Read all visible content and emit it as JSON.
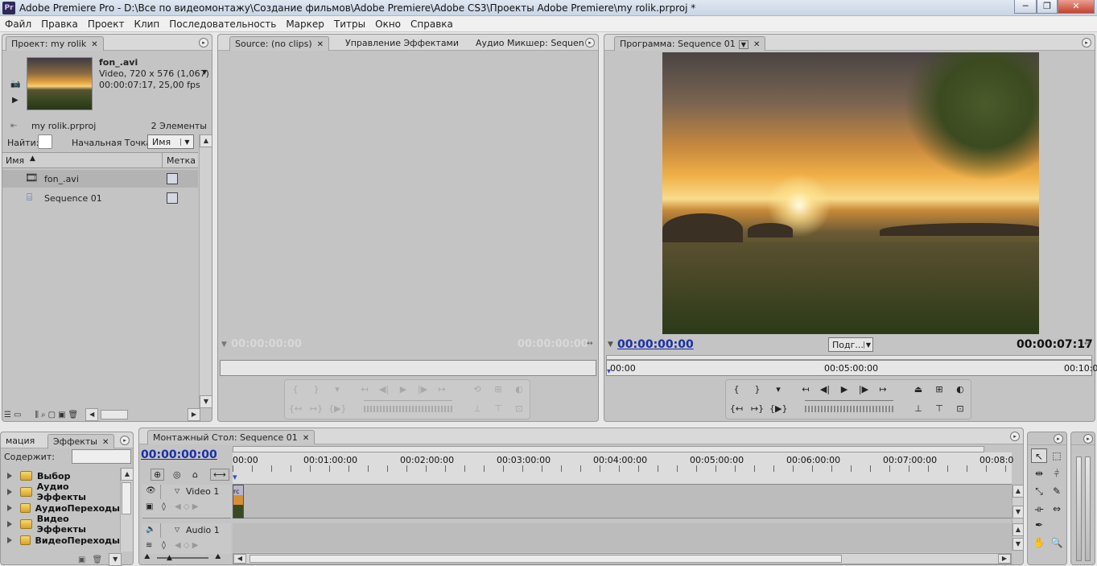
{
  "window": {
    "app_icon": "Pr",
    "title": "Adobe Premiere Pro - D:\\Все по видеомонтажу\\Создание фильмов\\Adobe Premiere\\Adobe CS3\\Проекты Adobe Premiere\\my rolik.prproj *",
    "controls": {
      "minimize": "─",
      "maximize": "❐",
      "close": "✕"
    }
  },
  "menu": [
    "Файл",
    "Правка",
    "Проект",
    "Клип",
    "Последовательность",
    "Маркер",
    "Титры",
    "Окно",
    "Справка"
  ],
  "project": {
    "tab": "Проект: my rolik",
    "clip_name": "fon_.avi",
    "clip_info1": "Video, 720 x 576 (1,067)",
    "clip_info2": "00:00:07:17, 25,00 fps",
    "file": "my rolik.prproj",
    "count": "2 Элементы",
    "find_label": "Найти:",
    "in_label": "Начальная Точка:",
    "in_value": "Имя",
    "col_name": "Имя",
    "col_label": "Метка",
    "items": [
      {
        "name": "fon_.avi",
        "icon": "film-icon"
      },
      {
        "name": "Sequence 01",
        "icon": "sequence-icon"
      }
    ]
  },
  "source": {
    "tabs": [
      "Source: (no clips)",
      "Управление Эффектами",
      "Аудио Микшер: Sequen"
    ],
    "tc_left": "00:00:00:00",
    "tc_right": "00:00:00:00"
  },
  "program": {
    "tab": "Программа: Sequence 01",
    "tc_current": "00:00:00:00",
    "fit": "Подг...",
    "tc_duration": "00:00:07:17",
    "ruler": [
      "00:00",
      "00:05:00:00",
      "00:10:0"
    ]
  },
  "effects": {
    "tabs": [
      "мация",
      "Эффекты"
    ],
    "contains_label": "Содержит:",
    "folders": [
      "Выбор",
      "Аудио Эффекты",
      "АудиоПереходы",
      "Видео Эффекты",
      "ВидеоПереходы"
    ]
  },
  "timeline": {
    "tab": "Монтажный Стол: Sequence 01",
    "tc": "00:00:00:00",
    "ruler": [
      "00:00",
      "00:01:00:00",
      "00:02:00:00",
      "00:03:00:00",
      "00:04:00:00",
      "00:05:00:00",
      "00:06:00:00",
      "00:07:00:00",
      "00:08:0"
    ],
    "video_track": "Video 1",
    "audio_track": "Audio 1",
    "clip_label": "rc"
  },
  "colors": {
    "timecode_blue": "#1a2fa8",
    "panel_bg": "#c4c4c4"
  }
}
